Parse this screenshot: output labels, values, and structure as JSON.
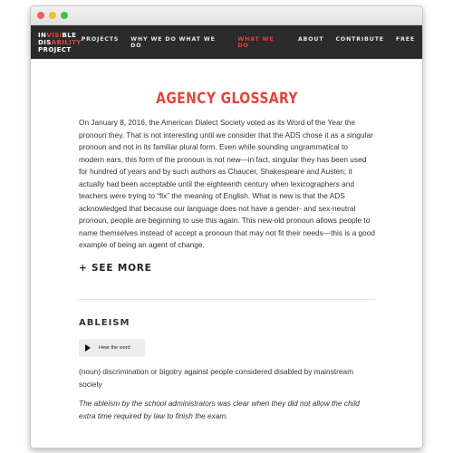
{
  "window": {
    "controls": [
      {
        "name": "close",
        "color": "#ee5f58"
      },
      {
        "name": "minimize",
        "color": "#f6be30"
      },
      {
        "name": "maximize",
        "color": "#3fc440"
      }
    ]
  },
  "logo": {
    "line1_a": "IN",
    "line1_b": "VISI",
    "line1_c": "BLE",
    "line2_a": "DIS",
    "line2_b": "A",
    "line2_c": "BILITY",
    "line3": "PROJECT",
    "accent": "#e8443a"
  },
  "nav": [
    {
      "label": "PROJECTS",
      "active": false
    },
    {
      "label": "WHY WE DO WHAT WE DO",
      "active": false
    },
    {
      "label": "WHAT WE DO",
      "active": true
    },
    {
      "label": "ABOUT",
      "active": false
    },
    {
      "label": "CONTRIBUTE",
      "active": false
    },
    {
      "label": "FREE",
      "active": false
    }
  ],
  "page": {
    "title": "AGENCY GLOSSARY",
    "intro": "On January 8, 2016, the American Dialect Society voted as its Word of the Year the pronoun they. That is not interesting until we consider that the ADS chose it as a singular pronoun and not in its familiar plural form. Even while sounding ungrammatical to modern ears, this form of the pronoun is not new—in fact, singular they has been used for hundred of years and by such authors as Chaucer, Shakespeare and Austen; it actually had been acceptable until the eighteenth century when lexicographers and teachers were trying to “fix” the meaning of English. What is new is that the ADS acknowledged that because our language does not have a gender- and sex-neutral pronoun, people are beginning to use this again. This new-old pronoun allows people to name themselves instead of accept a pronoun that may not fit their needs—this is a good example of being an agent of change.",
    "see_more": "+ SEE MORE"
  },
  "entry": {
    "term": "ABLEISM",
    "audio_label": "Hear the word",
    "definition": "(noun) discrimination or bigotry against people considered disabled by mainstream society",
    "example": "The ableism by the school administrators was clear when they did not allow the child extra time required by law to finish the exam."
  },
  "colors": {
    "accent": "#e8443a",
    "navbar_bg": "#2b2b2b"
  }
}
